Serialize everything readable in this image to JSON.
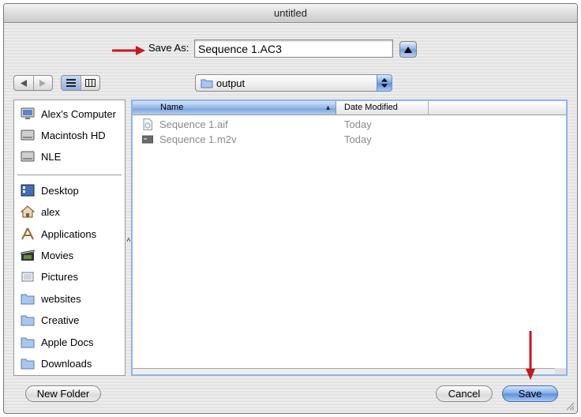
{
  "window": {
    "title": "untitled"
  },
  "save_as": {
    "label": "Save As:",
    "value": "Sequence 1.AC3"
  },
  "folder_popup": {
    "selected": "output"
  },
  "sidebar": {
    "devices": [
      {
        "label": "Alex's Computer",
        "icon": "computer-icon"
      },
      {
        "label": "Macintosh HD",
        "icon": "hard-drive-icon"
      },
      {
        "label": "NLE",
        "icon": "hard-drive-icon"
      }
    ],
    "places": [
      {
        "label": "Desktop",
        "icon": "desktop-icon"
      },
      {
        "label": "alex",
        "icon": "home-icon"
      },
      {
        "label": "Applications",
        "icon": "applications-icon"
      },
      {
        "label": "Movies",
        "icon": "movies-icon"
      },
      {
        "label": "Pictures",
        "icon": "pictures-icon"
      },
      {
        "label": "websites",
        "icon": "folder-icon"
      },
      {
        "label": "Creative",
        "icon": "folder-icon"
      },
      {
        "label": "Apple Docs",
        "icon": "folder-icon"
      },
      {
        "label": "Downloads",
        "icon": "folder-icon"
      }
    ]
  },
  "file_list": {
    "columns": {
      "name": "Name",
      "date": "Date Modified"
    },
    "rows": [
      {
        "name": "Sequence 1.aif",
        "date": "Today",
        "icon": "audio-file-icon"
      },
      {
        "name": "Sequence 1.m2v",
        "date": "Today",
        "icon": "video-file-icon"
      }
    ]
  },
  "buttons": {
    "new_folder": "New Folder",
    "cancel": "Cancel",
    "save": "Save"
  },
  "colors": {
    "annotation_arrow": "#c8161d",
    "accent": "#6f9de0"
  }
}
